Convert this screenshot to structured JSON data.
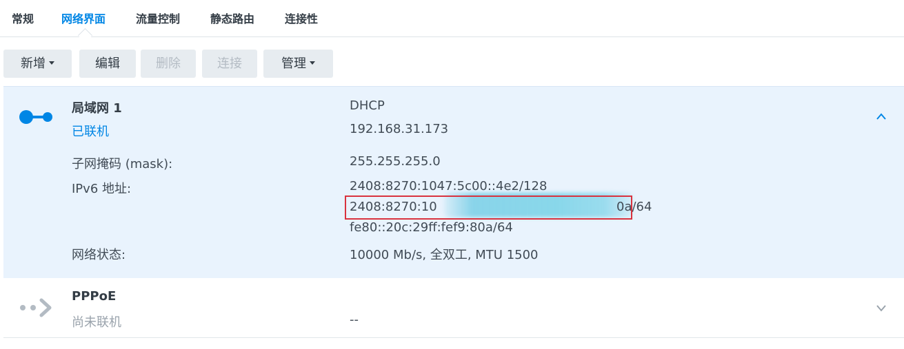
{
  "tabs": [
    {
      "label": "常规"
    },
    {
      "label": "网络界面"
    },
    {
      "label": "流量控制"
    },
    {
      "label": "静态路由"
    },
    {
      "label": "连接性"
    }
  ],
  "toolbar": {
    "add_label": "新增",
    "edit_label": "编辑",
    "delete_label": "删除",
    "connect_label": "连接",
    "manage_label": "管理"
  },
  "interfaces": [
    {
      "name": "局域网 1",
      "status": "已联机",
      "mode": "DHCP",
      "ip": "192.168.31.173",
      "details": {
        "mask_label": "子网掩码 (mask):",
        "mask_value": "255.255.255.0",
        "ipv6_label": "IPv6 地址:",
        "ipv6_1": "2408:8270:1047:5c00::4e2/128",
        "ipv6_2_visible_start": "2408:8270:10",
        "ipv6_2_visible_end": "0a/64",
        "ipv6_3": "fe80::20c:29ff:fef9:80a/64",
        "net_label": "网络状态:",
        "net_value": "10000 Mb/s, 全双工, MTU 1500"
      },
      "expanded": true
    },
    {
      "name": "PPPoE",
      "status": "尚未联机",
      "ip": "--",
      "expanded": false
    }
  ],
  "colors": {
    "accent": "#0086e5",
    "selected_row_bg": "#e9f3fd",
    "button_bg": "#e7ecf0",
    "highlight_box": "#d9323e",
    "redaction": "#7ed4e8"
  }
}
